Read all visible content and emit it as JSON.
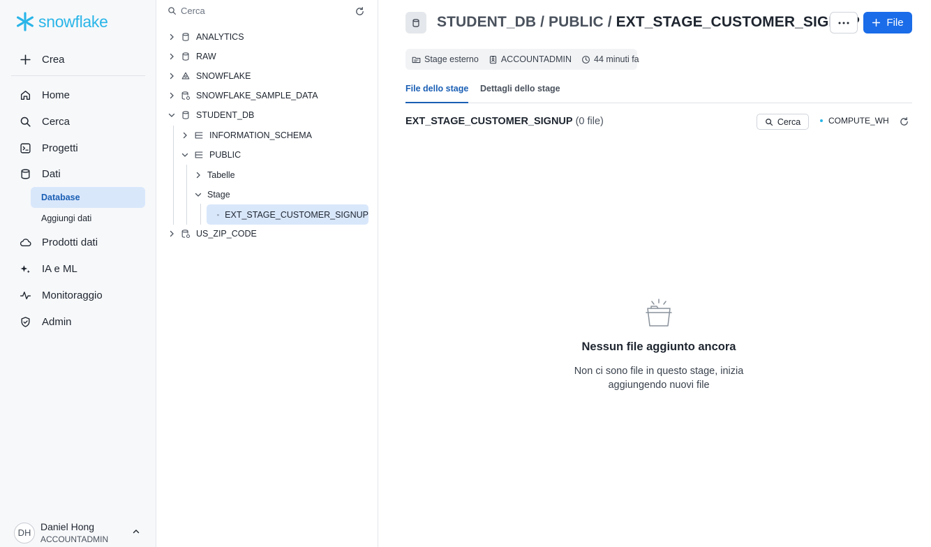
{
  "nav": {
    "logo_text": "snowflake",
    "create_label": "Crea",
    "items": [
      {
        "label": "Home",
        "icon": "home-icon"
      },
      {
        "label": "Cerca",
        "icon": "search-icon"
      },
      {
        "label": "Progetti",
        "icon": "projects-icon"
      },
      {
        "label": "Dati",
        "icon": "database-icon"
      },
      {
        "label": "Prodotti dati",
        "icon": "cloud-icon"
      },
      {
        "label": "IA e ML",
        "icon": "sparkle-icon"
      },
      {
        "label": "Monitoraggio",
        "icon": "activity-icon"
      },
      {
        "label": "Admin",
        "icon": "shield-icon"
      }
    ],
    "sub_items": [
      {
        "label": "Database",
        "active": true
      },
      {
        "label": "Aggiungi dati",
        "active": false
      }
    ],
    "user": {
      "initials": "DH",
      "name": "Daniel Hong",
      "role": "ACCOUNTADMIN"
    }
  },
  "tree": {
    "search_placeholder": "Cerca",
    "rows": [
      {
        "label": "ANALYTICS",
        "expanded": false,
        "type": "database"
      },
      {
        "label": "RAW",
        "expanded": false,
        "type": "database"
      },
      {
        "label": "SNOWFLAKE",
        "expanded": false,
        "type": "snowflake-db"
      },
      {
        "label": "SNOWFLAKE_SAMPLE_DATA",
        "expanded": false,
        "type": "shared-db"
      },
      {
        "label": "STUDENT_DB",
        "expanded": true,
        "type": "database"
      },
      {
        "label": "INFORMATION_SCHEMA",
        "expanded": false,
        "type": "schema"
      },
      {
        "label": "PUBLIC",
        "expanded": true,
        "type": "schema"
      },
      {
        "label": "Tabelle",
        "expanded": false,
        "type": "folder"
      },
      {
        "label": "Stage",
        "expanded": true,
        "type": "folder"
      },
      {
        "label": "EXT_STAGE_CUSTOMER_SIGNUP",
        "expanded": false,
        "type": "stage",
        "selected": true
      },
      {
        "label": "US_ZIP_CODE",
        "expanded": false,
        "type": "shared-db"
      }
    ]
  },
  "header": {
    "crumb_db": "STUDENT_DB",
    "crumb_sep": " / ",
    "crumb_schema": "PUBLIC",
    "crumb_object": "EXT_STAGE_CUSTOMER_SIGNUP",
    "file_button": "File"
  },
  "meta": {
    "type": "Stage esterno",
    "owner": "ACCOUNTADMIN",
    "modified": "44 minuti fa"
  },
  "tabs": [
    {
      "label": "File dello stage",
      "active": true
    },
    {
      "label": "Dettagli dello stage",
      "active": false
    }
  ],
  "content": {
    "stage_name": "EXT_STAGE_CUSTOMER_SIGNUP",
    "file_count": "(0 file)",
    "search_label": "Cerca",
    "warehouse": "COMPUTE_WH",
    "empty_title": "Nessun file aggiunto ancora",
    "empty_desc": "Non ci sono file in questo stage, inizia aggiungendo nuovi file"
  },
  "colors": {
    "accent": "#1a6ce8",
    "brand": "#29b5e8",
    "selected_bg": "#d9e7fb"
  }
}
